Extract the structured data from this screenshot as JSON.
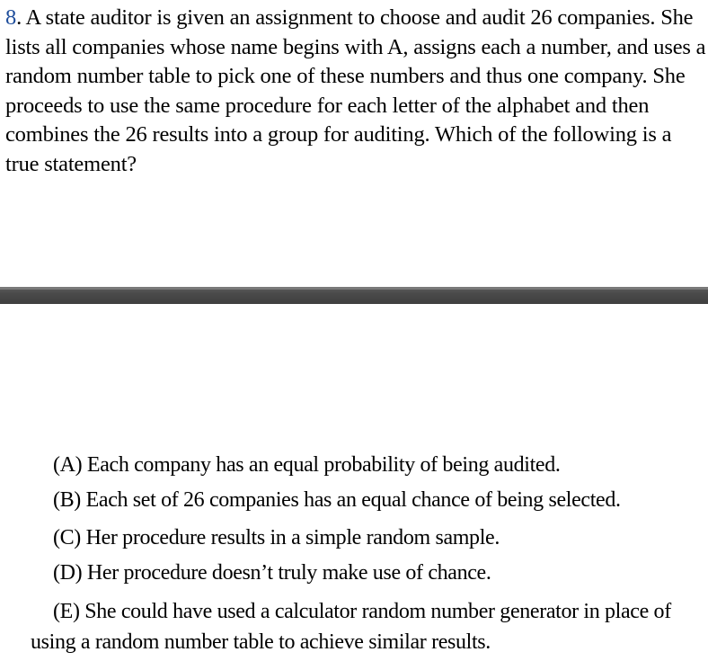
{
  "question": {
    "number": "8",
    "text": ". A state auditor is given an assignment to choose and audit 26 companies. She lists all companies whose name begins with A, assigns each a number, and uses a random number table to pick one of these numbers and thus one company. She proceeds to use the same procedure for each letter of the alphabet and then combines the 26 results into a group for auditing. Which of the following is a true statement?"
  },
  "colors": {
    "question_number": "#1f4e9c",
    "divider": "#4a4a4a"
  },
  "choices": [
    {
      "text": "(A) Each company has an equal probability of being audited."
    },
    {
      "text": "(B) Each set of 26 companies has an equal chance of being selected."
    },
    {
      "text": "(C) Her procedure results in a simple random sample."
    },
    {
      "text": "(D) Her procedure doesn’t truly make use of chance."
    },
    {
      "text": "(E) She could have used a calculator random number generator in place of using a random number table to achieve similar results."
    }
  ]
}
